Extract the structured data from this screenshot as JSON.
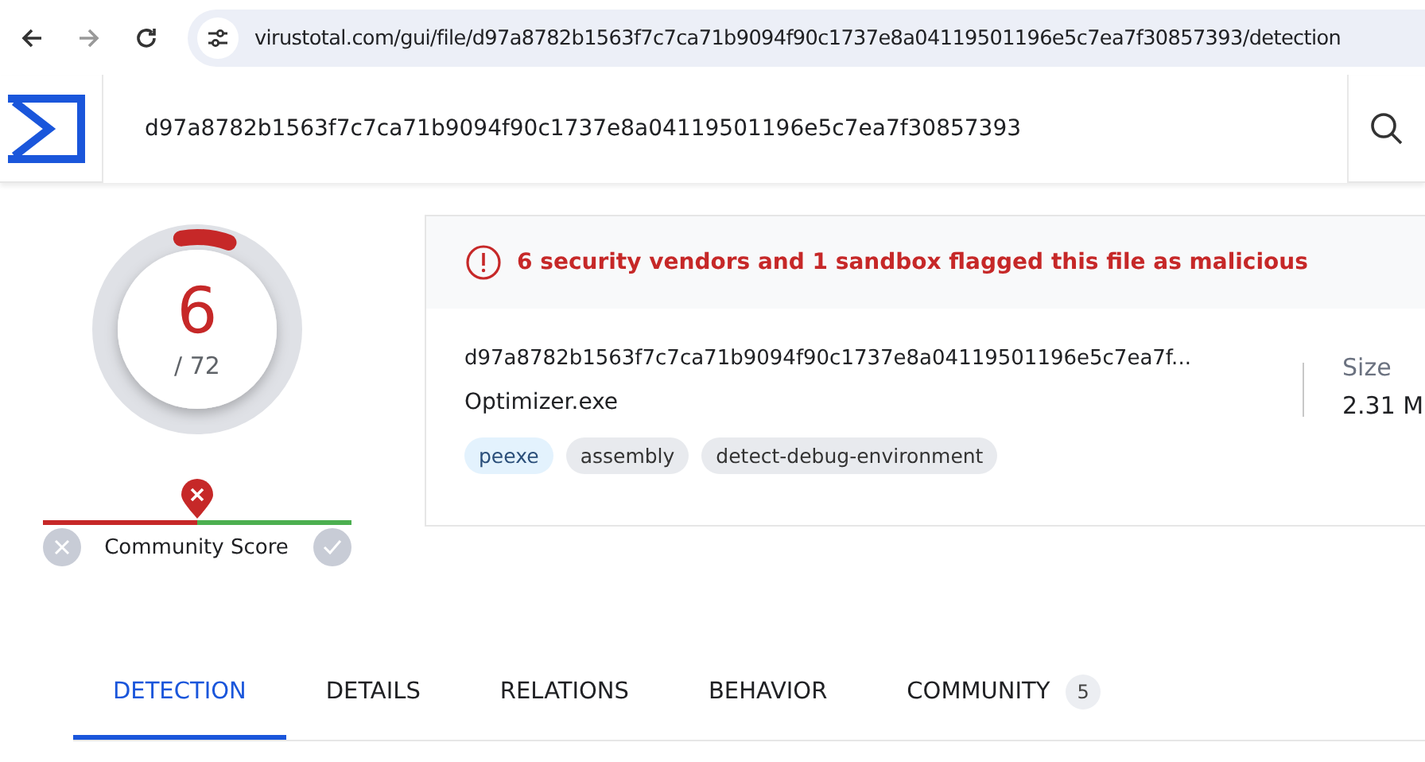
{
  "browser": {
    "url": "virustotal.com/gui/file/d97a8782b1563f7c7ca71b9094f90c1737e8a04119501196e5c7ea7f30857393/detection"
  },
  "search": {
    "value": "d97a8782b1563f7c7ca71b9094f90c1737e8a04119501196e5c7ea7f30857393"
  },
  "score": {
    "detections": "6",
    "total": "/ 72",
    "level": 0.083
  },
  "community": {
    "label": "Community Score",
    "level": 0.5
  },
  "alert": {
    "text": "6 security vendors and 1 sandbox flagged this file as malicious"
  },
  "file": {
    "hash": "d97a8782b1563f7c7ca71b9094f90c1737e8a04119501196e5c7ea7f...",
    "name": "Optimizer.exe",
    "tags": [
      {
        "label": "peexe",
        "kind": "filetype"
      },
      {
        "label": "assembly",
        "kind": "tag"
      },
      {
        "label": "detect-debug-environment",
        "kind": "tag"
      }
    ],
    "size_label": "Size",
    "size_value": "2.31 M"
  },
  "tabs": [
    {
      "label": "DETECTION",
      "selected": true
    },
    {
      "label": "DETAILS",
      "selected": false
    },
    {
      "label": "RELATIONS",
      "selected": false
    },
    {
      "label": "BEHAVIOR",
      "selected": false
    },
    {
      "label": "COMMUNITY",
      "selected": false,
      "count": "5"
    }
  ]
}
